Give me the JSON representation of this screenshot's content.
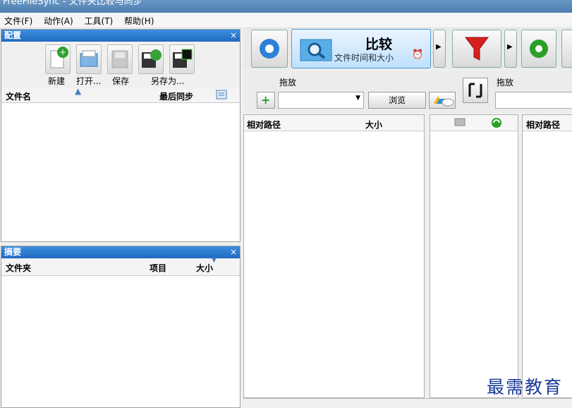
{
  "window": {
    "title": "FreeFileSync  -  文件夹比较与同步"
  },
  "menu": [
    "文件(F)",
    "动作(A)",
    "工具(T)",
    "帮助(H)"
  ],
  "config_panel": {
    "title": "配置",
    "close": "×",
    "buttons": [
      "新建",
      "打开...",
      "保存",
      "另存为..."
    ],
    "columns": {
      "name": "文件名",
      "last_sync": "最后同步"
    }
  },
  "summary_panel": {
    "title": "摘要",
    "close": "×",
    "columns": {
      "folder": "文件夹",
      "items": "项目",
      "size": "大小"
    }
  },
  "main_toolbar": {
    "compare_label": "比较",
    "compare_sub": "文件时间和大小"
  },
  "folder_pair": {
    "left_drop": "拖放",
    "browse": "浏览",
    "right_drop": "拖放"
  },
  "file_grid": {
    "left_columns": [
      "相对路径",
      "大小"
    ],
    "right_columns": [
      "相对路径"
    ]
  },
  "watermark": "最需教育"
}
